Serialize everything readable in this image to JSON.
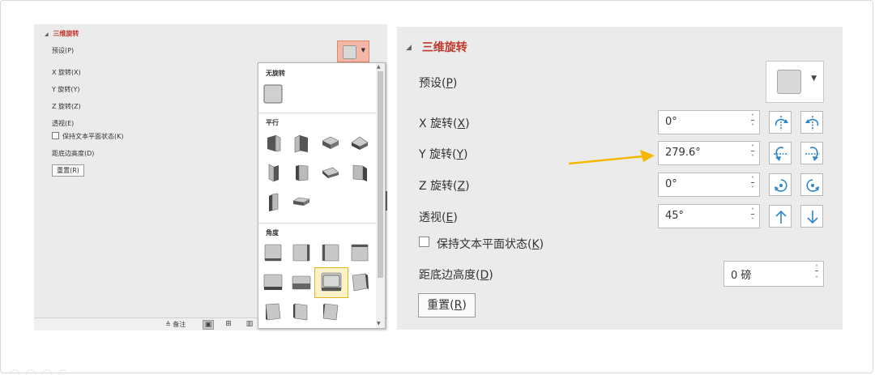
{
  "left_panel": {
    "section_title": "三维旋转",
    "preset_label": "预设(P)",
    "x_label": "X 旋转(X)",
    "y_label": "Y 旋转(Y)",
    "z_label": "Z 旋转(Z)",
    "perspective_label": "透视(E)",
    "keep_flat_label": "保持文本平面状态(K)",
    "distance_label": "距底边高度(D)",
    "reset_label": "重置(R)",
    "status_notes": "备注"
  },
  "gallery": {
    "section_none": "无旋转",
    "section_parallel": "平行",
    "section_angle": "角度"
  },
  "right_panel": {
    "section_title": "三维旋转",
    "preset": {
      "prefix": "预设(",
      "key": "P",
      "suffix": ")"
    },
    "x": {
      "prefix": "X 旋转(",
      "key": "X",
      "suffix": ")",
      "value": "0°"
    },
    "y": {
      "prefix": "Y 旋转(",
      "key": "Y",
      "suffix": ")",
      "value": "279.6°"
    },
    "z": {
      "prefix": "Z 旋转(",
      "key": "Z",
      "suffix": ")",
      "value": "0°"
    },
    "perspective": {
      "prefix": "透视(",
      "key": "E",
      "suffix": ")",
      "value": "45°"
    },
    "keep_flat": {
      "prefix": "保持文本平面状态(",
      "key": "K",
      "suffix": ")"
    },
    "distance": {
      "prefix": "距底边高度(",
      "key": "D",
      "suffix": ")",
      "value": "0 磅"
    },
    "reset": {
      "prefix": "重置(",
      "key": "R",
      "suffix": ")"
    }
  },
  "colors": {
    "accent_red": "#c0392b",
    "annotation_arrow": "#f5b800",
    "icon_blue": "#2e86c8"
  }
}
